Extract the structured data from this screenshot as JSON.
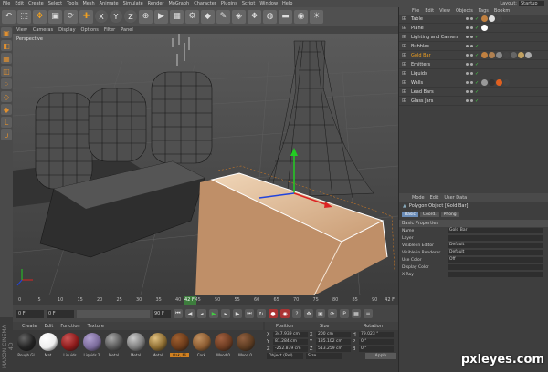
{
  "menubar": {
    "items": [
      "File",
      "Edit",
      "Create",
      "Select",
      "Tools",
      "Mesh",
      "Animate",
      "Simulate",
      "Render",
      "MoGraph",
      "Character",
      "Plugins",
      "Script",
      "Window",
      "Help"
    ],
    "layout_label": "Layout:",
    "layout_value": "Startup"
  },
  "viewport": {
    "menu": [
      "View",
      "Cameras",
      "Display",
      "Options",
      "Filter",
      "Panel"
    ],
    "label": "Perspective"
  },
  "timeline": {
    "ticks": [
      "0",
      "5",
      "10",
      "15",
      "20",
      "25",
      "30",
      "35",
      "40",
      "45",
      "50",
      "55",
      "60",
      "65",
      "70",
      "75",
      "80",
      "85",
      "90"
    ],
    "current_frame": "42 F",
    "end_label": "42 F"
  },
  "playbar": {
    "start": "0 F",
    "field2": "0 F",
    "field3": "90 F",
    "field4": "90 F"
  },
  "materials": {
    "menu": [
      "Create",
      "Edit",
      "Function",
      "Texture"
    ],
    "items": [
      {
        "label": "Rough Gl",
        "color": "#222222",
        "hi": "#666666"
      },
      {
        "label": "Mat",
        "color": "#eeeeee",
        "hi": "#ffffff"
      },
      {
        "label": "Liquids",
        "color": "#8a1a1a",
        "hi": "#cc5555"
      },
      {
        "label": "Liquids 2",
        "color": "#7a6a9a",
        "hi": "#b0a0d0"
      },
      {
        "label": "Metal",
        "color": "#555555",
        "hi": "#aaaaaa"
      },
      {
        "label": "Metal",
        "color": "#7a7a7a",
        "hi": "#cccccc"
      },
      {
        "label": "Metal",
        "color": "#8a6a30",
        "hi": "#e0c080"
      },
      {
        "label": "Oak, Mi",
        "color": "#6a3a1a",
        "hi": "#a06030",
        "selected": true
      },
      {
        "label": "Cork",
        "color": "#8a5a30",
        "hi": "#c09060"
      },
      {
        "label": "Wood 0",
        "color": "#6a3a20",
        "hi": "#a06040"
      },
      {
        "label": "Wood 0",
        "color": "#5a3a20",
        "hi": "#906040"
      }
    ]
  },
  "coordinates": {
    "headers": [
      "Position",
      "Size",
      "Rotation"
    ],
    "rows": [
      {
        "pos_axis": "X",
        "pos": "347.939 cm",
        "size_axis": "X",
        "size": "200 cm",
        "rot_axis": "H",
        "rot": "79.023 °"
      },
      {
        "pos_axis": "Y",
        "pos": "81.284 cm",
        "size_axis": "Y",
        "size": "135.102 cm",
        "rot_axis": "P",
        "rot": "0 °"
      },
      {
        "pos_axis": "Z",
        "pos": "-252.879 cm",
        "size_axis": "Z",
        "size": "513.259 cm",
        "rot_axis": "B",
        "rot": "0 °"
      }
    ],
    "mode": "Object (Rel)",
    "size_mode": "Size",
    "apply": "Apply"
  },
  "objects": {
    "tabs": [
      "File",
      "Edit",
      "View",
      "Objects",
      "Tags",
      "Bookm"
    ],
    "items": [
      {
        "name": "Table",
        "selected": false,
        "tags": [
          "#c08040",
          "#e0e0e0",
          "#444444"
        ]
      },
      {
        "name": "Plane",
        "selected": false,
        "tags": [
          "#ffffff"
        ]
      },
      {
        "name": "Lighting and Camera",
        "selected": false,
        "tags": []
      },
      {
        "name": "Bubbles",
        "selected": false,
        "tags": []
      },
      {
        "name": "Gold Bar",
        "selected": true,
        "tags": [
          "#c08040",
          "#b08050",
          "#888888",
          "#444444",
          "#666666",
          "#c0a060",
          "#aaaaaa"
        ]
      },
      {
        "name": "Emitters",
        "selected": false,
        "tags": []
      },
      {
        "name": "Liquids",
        "selected": false,
        "tags": []
      },
      {
        "name": "Walls",
        "selected": false,
        "tags": [
          "#999999",
          "#333333",
          "#e06020",
          "#444444"
        ]
      },
      {
        "name": "Lead Bars",
        "selected": false,
        "tags": []
      },
      {
        "name": "Glass Jars",
        "selected": false,
        "tags": []
      }
    ]
  },
  "attributes": {
    "menu": [
      "Mode",
      "Edit",
      "User Data"
    ],
    "title": "Polygon Object [Gold Bar]",
    "tabs": [
      "Basic",
      "Coord.",
      "Phong"
    ],
    "section": "Basic Properties",
    "rows": [
      {
        "label": "Name",
        "value": "Gold Bar",
        "dim": false
      },
      {
        "label": "Layer",
        "value": "",
        "dim": false
      },
      {
        "label": "Visible in Editor",
        "value": "Default",
        "dim": false
      },
      {
        "label": "Visible in Renderer",
        "value": "Default",
        "dim": false
      },
      {
        "label": "Use Color",
        "value": "Off",
        "dim": false
      },
      {
        "label": "Display Color",
        "value": "",
        "dim": true
      },
      {
        "label": "X-Ray",
        "value": "",
        "dim": false
      }
    ]
  },
  "watermark": "pxleyes.com",
  "app_logo": "MAXON CINEMA 4D",
  "colors": {
    "accent": "#f0a020",
    "gold_bar": "#d8b898",
    "selected_obj": "#f0a020"
  }
}
